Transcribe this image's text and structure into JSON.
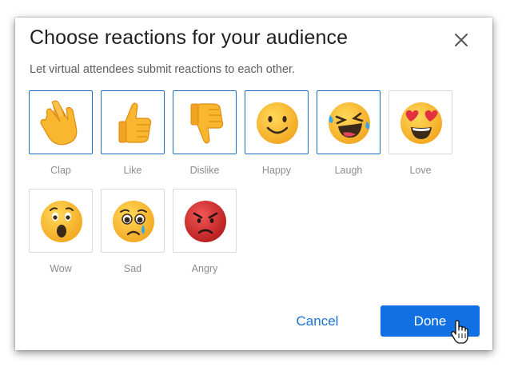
{
  "dialog": {
    "title": "Choose reactions for your audience",
    "subtitle": "Let virtual attendees submit reactions to each other.",
    "close_icon": "close-icon"
  },
  "reactions": [
    {
      "label": "Clap",
      "icon": "clap-emoji-icon",
      "selected": true
    },
    {
      "label": "Like",
      "icon": "thumbs-up-emoji-icon",
      "selected": true
    },
    {
      "label": "Dislike",
      "icon": "thumbs-down-emoji-icon",
      "selected": true
    },
    {
      "label": "Happy",
      "icon": "smiling-face-emoji-icon",
      "selected": true
    },
    {
      "label": "Laugh",
      "icon": "laughing-face-emoji-icon",
      "selected": true
    },
    {
      "label": "Love",
      "icon": "heart-eyes-emoji-icon",
      "selected": false
    },
    {
      "label": "Wow",
      "icon": "surprised-face-emoji-icon",
      "selected": false
    },
    {
      "label": "Sad",
      "icon": "sad-face-emoji-icon",
      "selected": false
    },
    {
      "label": "Angry",
      "icon": "angry-face-emoji-icon",
      "selected": false
    }
  ],
  "footer": {
    "cancel_label": "Cancel",
    "done_label": "Done"
  },
  "colors": {
    "accent": "#1170e4",
    "selected_border": "#1d6fbf",
    "link": "#1a73d6",
    "emoji_yellow": "#f7b52c",
    "angry_red": "#d42a2a"
  }
}
